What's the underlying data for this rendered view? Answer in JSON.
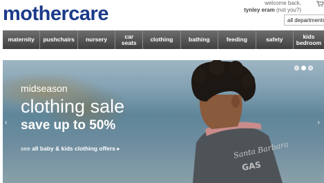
{
  "header": {
    "logo": "mothercare",
    "welcome": "welcome back,",
    "username": "tynley eram",
    "not_you": "(not you?)",
    "department_select": "all departments"
  },
  "nav": {
    "items": [
      {
        "label": "maternity"
      },
      {
        "label": "pushchairs"
      },
      {
        "label": "nursery"
      },
      {
        "label": "car seats"
      },
      {
        "label": "clothing"
      },
      {
        "label": "bathing"
      },
      {
        "label": "feeding"
      },
      {
        "label": "safety"
      },
      {
        "label": "kids bedroom"
      }
    ]
  },
  "hero": {
    "line1": "midseason",
    "line2": "clothing sale",
    "line3": "save up to 50%",
    "link_prefix": "see",
    "link_bold": "all baby & kids clothing offers",
    "prev_arrow": "‹",
    "next_arrow": "›",
    "slides": 3,
    "active_slide": 2
  },
  "colors": {
    "brand": "#1b3a8a",
    "nav_bg": "#4f4f4f"
  }
}
